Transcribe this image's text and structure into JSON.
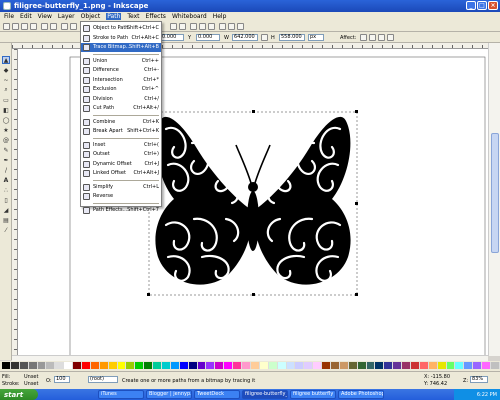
{
  "window": {
    "title": "filigree-butterfly_1.png - Inkscape",
    "controls": [
      "_",
      "□",
      "×"
    ]
  },
  "menubar": {
    "items": [
      "File",
      "Edit",
      "View",
      "Layer",
      "Object",
      "Path",
      "Text",
      "Effects",
      "Whiteboard",
      "Help"
    ],
    "active": "Path"
  },
  "controls": {
    "x_label": "X",
    "x_value": "0.000",
    "y_label": "Y",
    "y_value": "0.000",
    "w_label": "W",
    "w_value": "642.000",
    "h_label": "H",
    "h_value": "558.000",
    "unit": "px",
    "affect_label": "Affect:"
  },
  "path_menu": {
    "items": [
      {
        "label": "Object to Path",
        "shortcut": "Shift+Ctrl+C",
        "highlight": false
      },
      {
        "label": "Stroke to Path",
        "shortcut": "Ctrl+Alt+C",
        "highlight": false
      },
      {
        "label": "Trace Bitmap...",
        "shortcut": "Shift+Alt+B",
        "highlight": true
      },
      {
        "label": "Union",
        "shortcut": "Ctrl++",
        "highlight": false
      },
      {
        "label": "Difference",
        "shortcut": "Ctrl+-",
        "highlight": false
      },
      {
        "label": "Intersection",
        "shortcut": "Ctrl+*",
        "highlight": false
      },
      {
        "label": "Exclusion",
        "shortcut": "Ctrl+^",
        "highlight": false
      },
      {
        "label": "Division",
        "shortcut": "Ctrl+/",
        "highlight": false
      },
      {
        "label": "Cut Path",
        "shortcut": "Ctrl+Alt+/",
        "highlight": false
      },
      {
        "label": "Combine",
        "shortcut": "Ctrl+K",
        "highlight": false
      },
      {
        "label": "Break Apart",
        "shortcut": "Shift+Ctrl+K",
        "highlight": false
      },
      {
        "label": "Inset",
        "shortcut": "Ctrl+(",
        "highlight": false
      },
      {
        "label": "Outset",
        "shortcut": "Ctrl+)",
        "highlight": false
      },
      {
        "label": "Dynamic Offset",
        "shortcut": "Ctrl+J",
        "highlight": false
      },
      {
        "label": "Linked Offset",
        "shortcut": "Ctrl+Alt+J",
        "highlight": false
      },
      {
        "label": "Simplify",
        "shortcut": "Ctrl+L",
        "highlight": false
      },
      {
        "label": "Reverse",
        "shortcut": "",
        "highlight": false
      },
      {
        "label": "Path Effects...",
        "shortcut": "Shift+Ctrl+7",
        "highlight": false
      }
    ]
  },
  "status": {
    "fill_label": "Fill:",
    "fill_value": "Unset",
    "stroke_label": "Stroke:",
    "stroke_value": "Unset",
    "opacity_label": "O:",
    "opacity_value": "100",
    "layer_value": "(root)",
    "message": "Create one or more paths from a bitmap by tracing it",
    "cursor_x": "X: -115.80",
    "cursor_y": "Y: 746.42",
    "zoom_label": "Z:",
    "zoom_value": "83%"
  },
  "taskbar": {
    "start_label": "start",
    "tasks": [
      {
        "label": "iTunes",
        "active": false
      },
      {
        "label": "Blogger | jennyp...",
        "active": false
      },
      {
        "label": "TweetDeck",
        "active": false
      },
      {
        "label": "filigree-butterfly_1...",
        "active": true
      },
      {
        "label": "filigree butterfly",
        "active": false
      },
      {
        "label": "Adobe Photoshop",
        "active": false
      }
    ],
    "clock": "6:22 PM"
  },
  "colors": {
    "accent": "#316ac5",
    "titlebar": "#245edb",
    "start": "#3c9a33"
  }
}
